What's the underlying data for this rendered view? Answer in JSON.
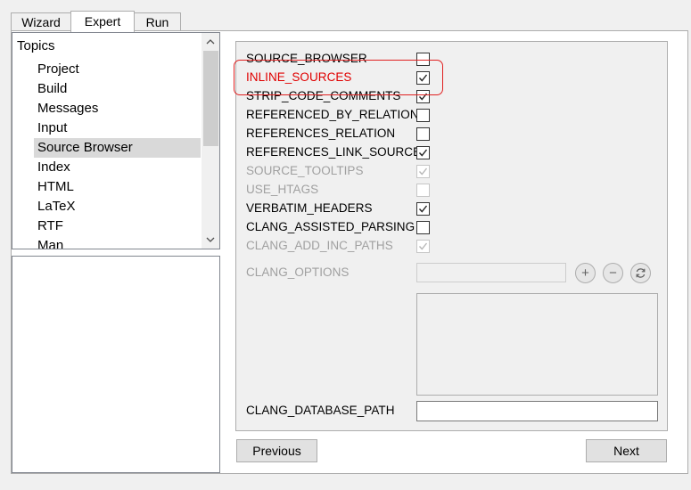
{
  "tabs": [
    {
      "label": "Wizard"
    },
    {
      "label": "Expert"
    },
    {
      "label": "Run"
    }
  ],
  "topics": {
    "header": "Topics",
    "items": [
      "Project",
      "Build",
      "Messages",
      "Input",
      "Source Browser",
      "Index",
      "HTML",
      "LaTeX",
      "RTF",
      "Man"
    ],
    "selected": "Source Browser"
  },
  "options": [
    {
      "label": "SOURCE_BROWSER",
      "checked": false,
      "enabled": true
    },
    {
      "label": "INLINE_SOURCES",
      "checked": true,
      "enabled": true,
      "changed": true
    },
    {
      "label": "STRIP_CODE_COMMENTS",
      "checked": true,
      "enabled": true
    },
    {
      "label": "REFERENCED_BY_RELATION",
      "checked": false,
      "enabled": true
    },
    {
      "label": "REFERENCES_RELATION",
      "checked": false,
      "enabled": true
    },
    {
      "label": "REFERENCES_LINK_SOURCE",
      "checked": true,
      "enabled": true
    },
    {
      "label": "SOURCE_TOOLTIPS",
      "checked": true,
      "enabled": false
    },
    {
      "label": "USE_HTAGS",
      "checked": false,
      "enabled": false
    },
    {
      "label": "VERBATIM_HEADERS",
      "checked": true,
      "enabled": true
    },
    {
      "label": "CLANG_ASSISTED_PARSING",
      "checked": false,
      "enabled": true
    },
    {
      "label": "CLANG_ADD_INC_PATHS",
      "checked": true,
      "enabled": false
    }
  ],
  "clang_options": {
    "label": "CLANG_OPTIONS",
    "value": "",
    "enabled": false
  },
  "clang_database_path": {
    "label": "CLANG_DATABASE_PATH",
    "value": ""
  },
  "buttons": {
    "previous": "Previous",
    "next": "Next"
  },
  "icons": {
    "add": "plus-icon",
    "remove": "minus-icon",
    "reset": "reset-icon"
  },
  "colors": {
    "changed_text": "#e00000",
    "highlight": "#e02020",
    "selected_bg": "#d9d9d9"
  }
}
